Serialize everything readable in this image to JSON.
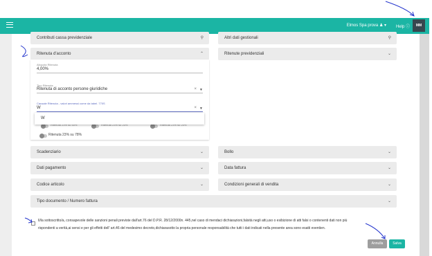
{
  "header": {
    "user": "Elmos Spa prova",
    "help": "Help",
    "avatar": "MM"
  },
  "panels": {
    "contributi": "Contributi cassa previdenziale",
    "altri_dati": "Altri dati gestionali",
    "ritenuta_acconto": "Ritenuta d'acconto",
    "ritenute_previdenziali": "Ritenute previdenziali",
    "scadenziario": "Scadenziario",
    "bollo": "Bollo",
    "dati_pagamento": "Dati pagamento",
    "dati_fattura": "Data fattura",
    "codice_articolo": "Codice articolo",
    "condizioni": "Condizioni generali di vendita",
    "tipo_documento": "Tipo documento / Numero fattura"
  },
  "ritenuta_form": {
    "aliquota_label": "Aliquota Ritenuta",
    "aliquota_value": "4,00%",
    "tipo_label": "Tipo Ritenuta",
    "tipo_value": "Ritenuta di acconto persone giuridiche",
    "causale_label": "Causale Ritenuta - valori ammessi come da tabel. 770S",
    "causale_value": "W",
    "dropdown_option": "W",
    "faded_1": "Ritenuta 23% su 50%",
    "faded_2": "Ritenuta 23% su 20%",
    "faded_3": "Ritenuta 23% su 20%",
    "option_last": "Ritenuta 23% su 78%"
  },
  "footer": {
    "declaration_1": "Il/la sottoscritto/a, consapevole delle sanzioni penali previste dall'art.76 del D.P.R. 28/12/2000n. 445,nel caso di mendaci dichiarazioni,falsità negli atti,uso o esibizione di atti falsi o contenenti dati non più",
    "declaration_2": "rispondenti a verità,ai sensi e per gli effetti dell' art.46 del medesimo decreto,dichiarasotto la propria personale responsabilità che tutti i dati indicati nella presente area sono esatti eventien.",
    "cancel": "Annulla",
    "save": "Salva"
  },
  "colors": {
    "accent": "#1bb5a4",
    "annotation": "#2233cc"
  }
}
